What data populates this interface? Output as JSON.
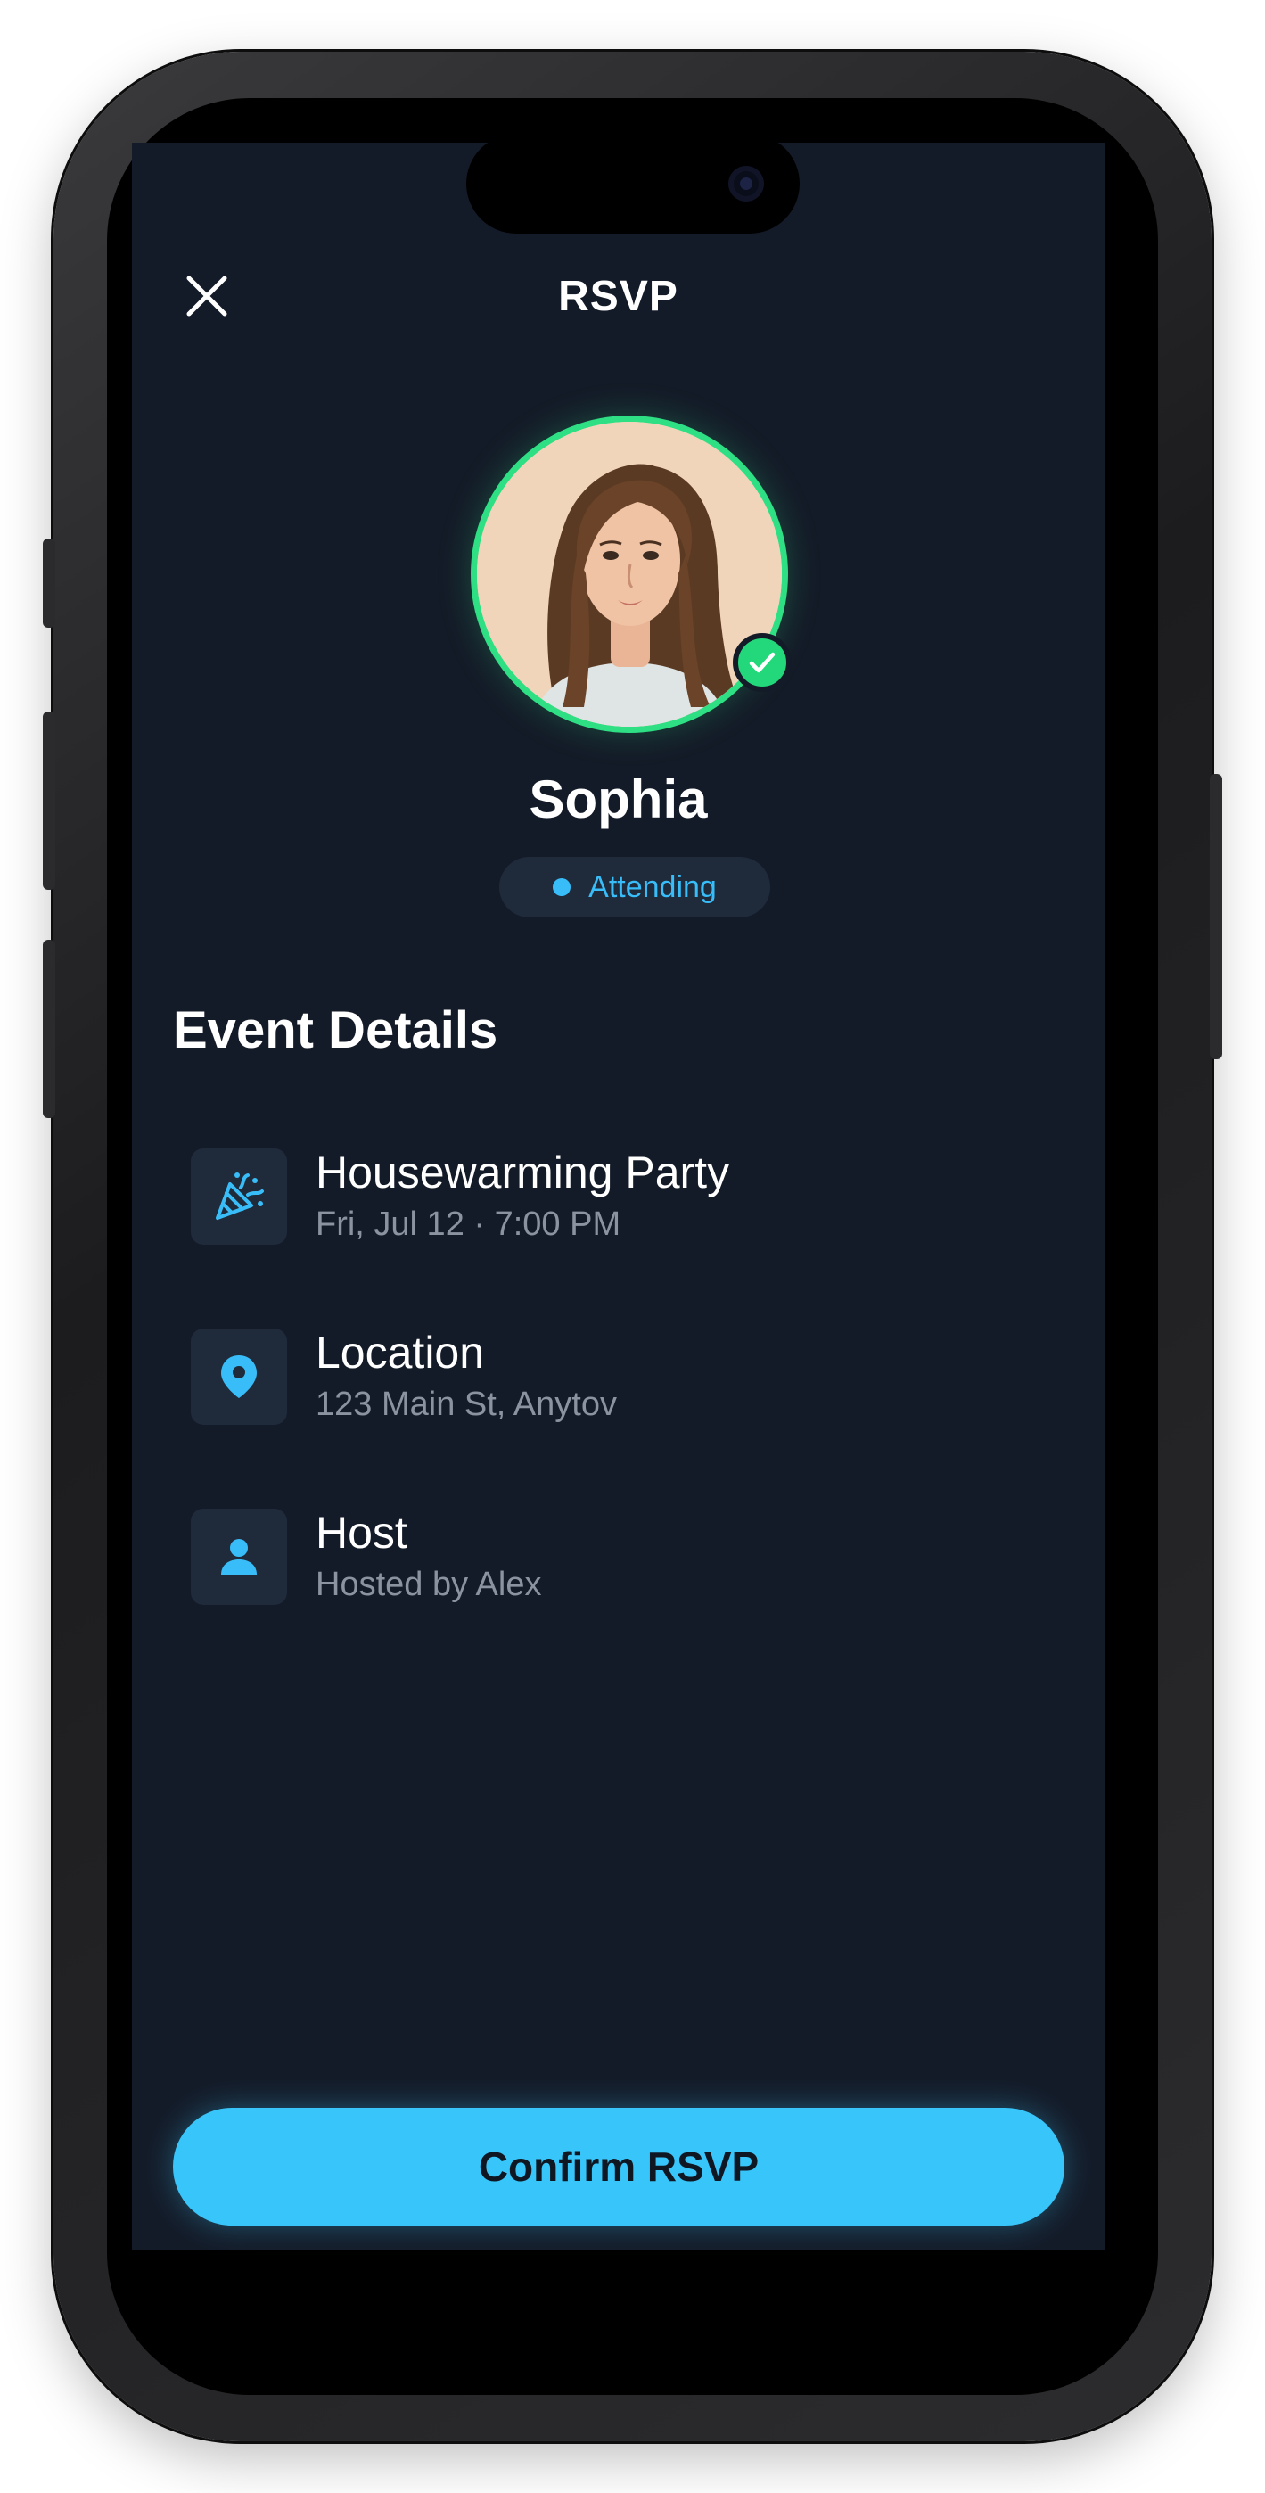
{
  "header": {
    "title": "RSVP",
    "close_icon": "close-icon"
  },
  "profile": {
    "name": "Sophia",
    "status": "Attending",
    "ring_color": "#2fdf84",
    "status_color": "#38bdf8",
    "badge_icon": "check-icon"
  },
  "event_details": {
    "heading": "Event Details",
    "items": [
      {
        "icon": "party-popper-icon",
        "title": "Housewarming Party",
        "subtitle": "Fri, Jul 12 · 7:00 PM"
      },
      {
        "icon": "location-pin-icon",
        "title": "Location",
        "subtitle": "123 Main St, Anytov"
      },
      {
        "icon": "person-icon",
        "title": "Host",
        "subtitle": "Hosted by Alex"
      }
    ]
  },
  "footer": {
    "confirm_label": "Confirm RSVP",
    "accent": "#38c5fa"
  }
}
